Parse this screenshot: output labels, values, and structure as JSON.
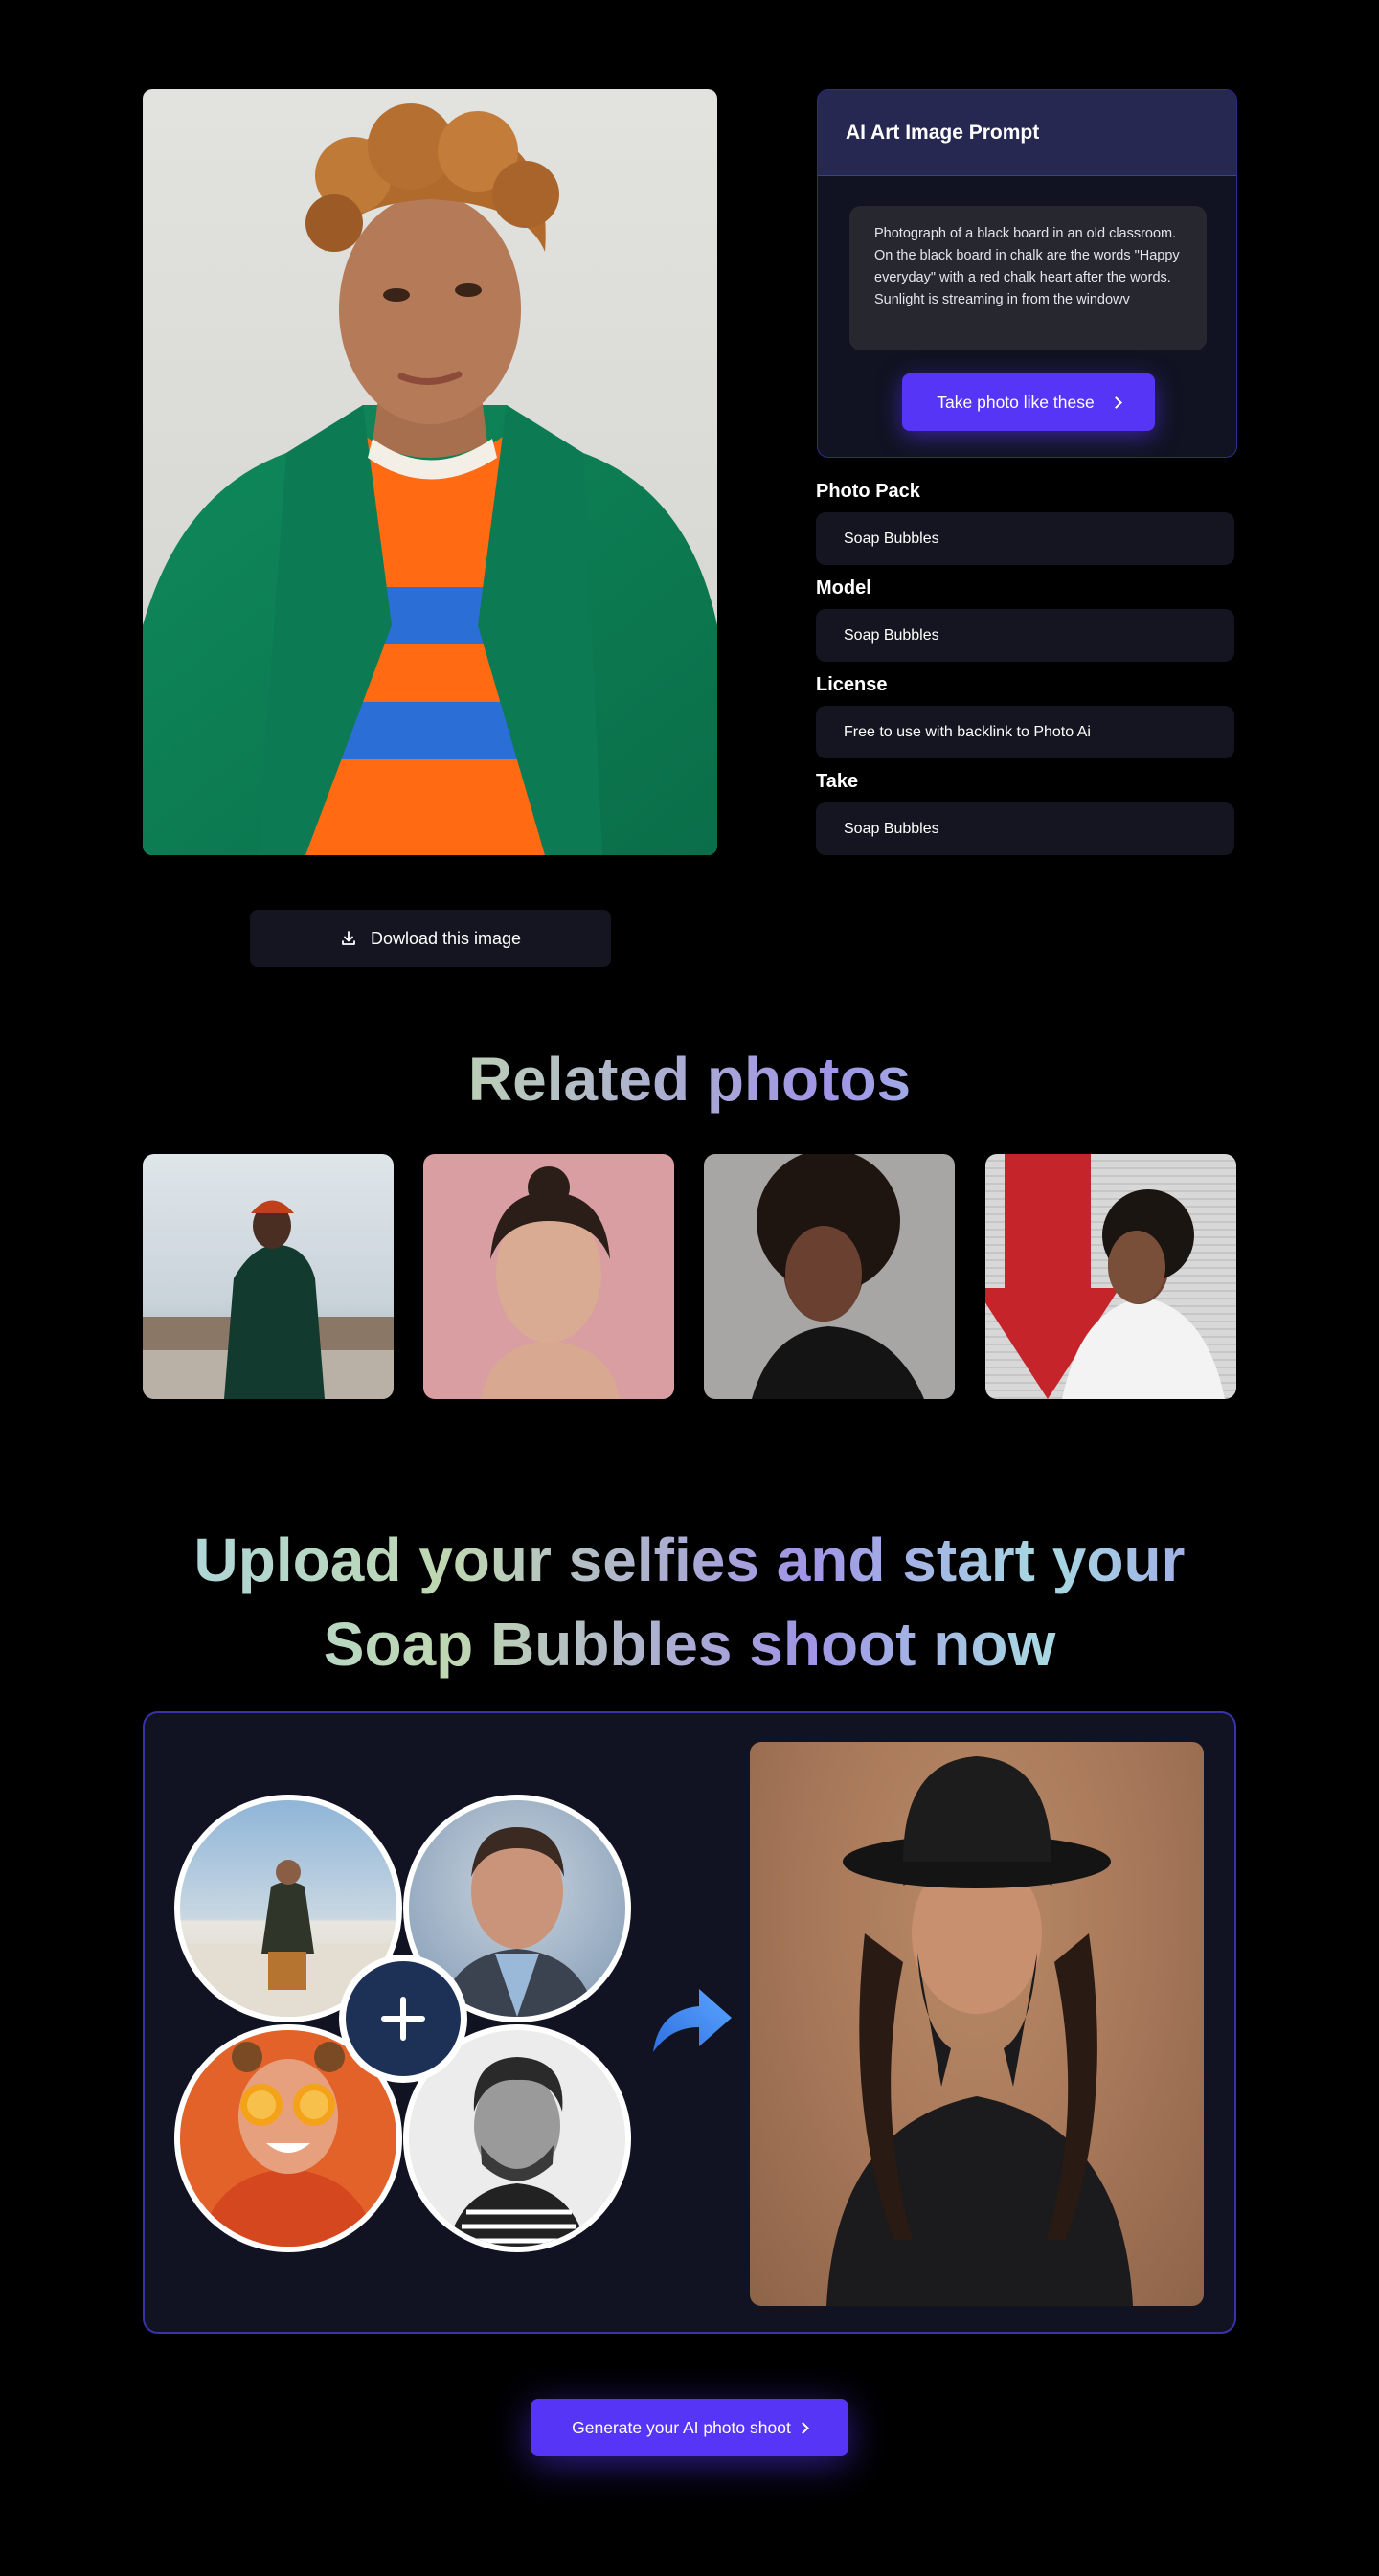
{
  "prompt_card": {
    "title": "AI Art Image Prompt",
    "prompt_text": "Photograph of a black board in an old classroom. On the black board in chalk are the words \"Happy everyday\" with a red chalk heart after the words. Sunlight is streaming in from the windowv",
    "button_label": "Take photo like these"
  },
  "details": {
    "photo_pack_label": "Photo Pack",
    "photo_pack_value": "Soap Bubbles",
    "model_label": "Model",
    "model_value": "Soap Bubbles",
    "license_label": "License",
    "license_value": "Free to use with backlink to Photo Ai",
    "take_label": "Take",
    "take_value": "Soap Bubbles"
  },
  "download_label": "Dowload this image",
  "related": {
    "title": "Related photos"
  },
  "upload": {
    "title_line1": "Upload your selfies and start your",
    "title_line2": "Soap Bubbles shoot now",
    "button_label": "Generate your AI photo shoot"
  },
  "colors": {
    "accent": "#5635f7",
    "card_bg": "#111322",
    "field_bg": "#141520",
    "card_border": "#3a33a8"
  },
  "icons": [
    "download-icon",
    "chevron-right-icon",
    "plus-icon",
    "curved-arrow-icon"
  ]
}
